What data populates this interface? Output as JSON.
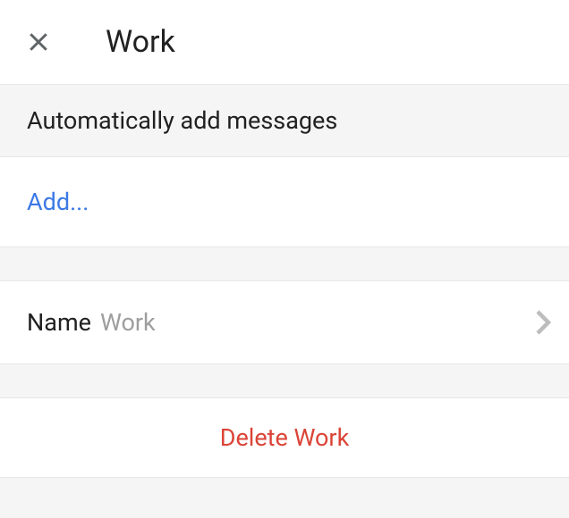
{
  "header": {
    "title": "Work"
  },
  "section": {
    "heading": "Automatically add messages",
    "add_label": "Add..."
  },
  "name_row": {
    "label": "Name",
    "value": "Work"
  },
  "delete": {
    "label": "Delete Work"
  },
  "colors": {
    "accent_link": "#3b79e6",
    "danger": "#db4437"
  }
}
